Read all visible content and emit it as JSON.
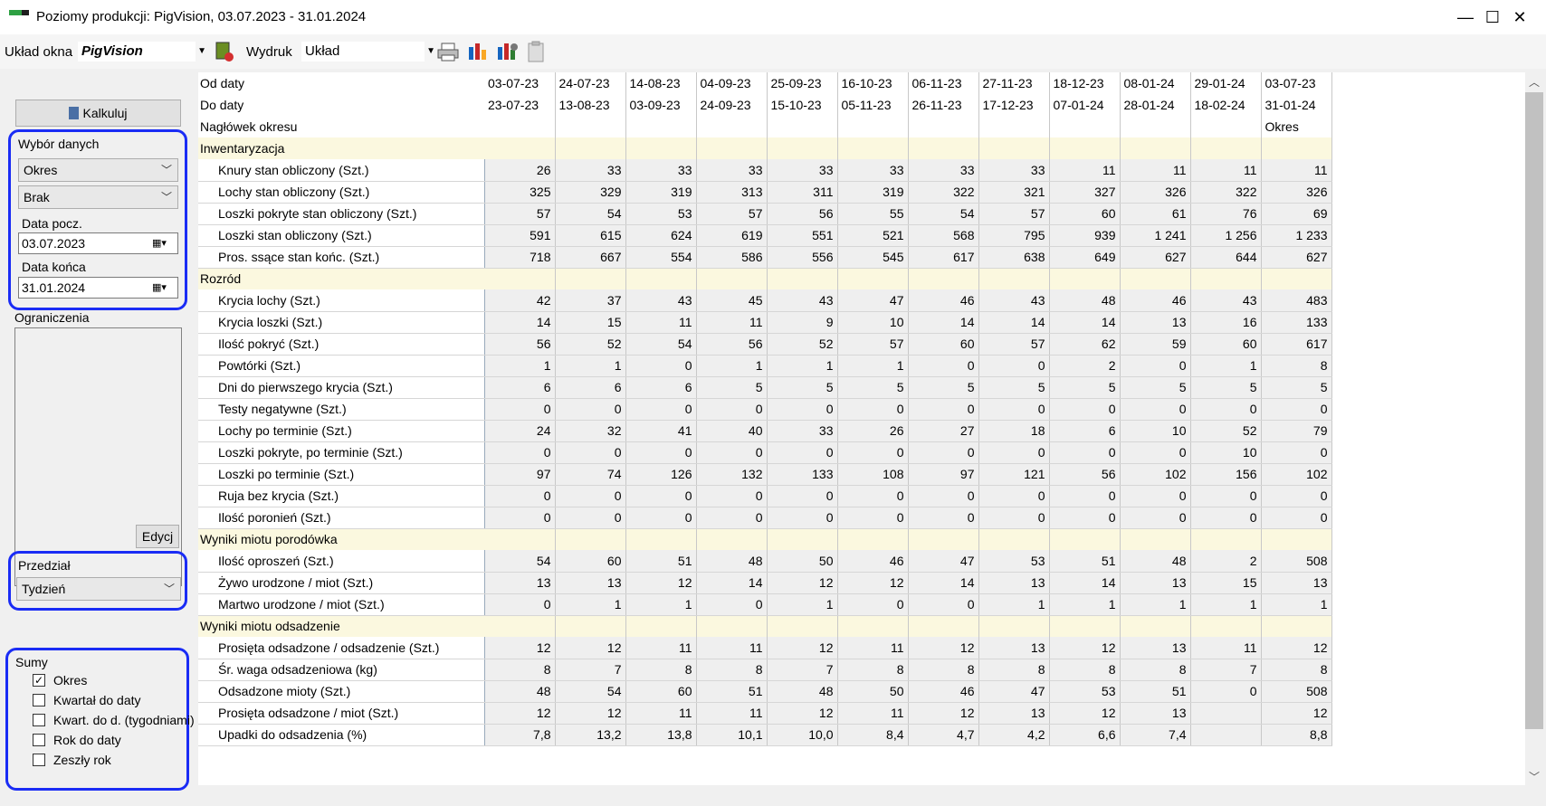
{
  "window": {
    "title": "Poziomy produkcji: PigVision, 03.07.2023 - 31.01.2024",
    "minimize": "—",
    "maximize": "☐",
    "close": "✕"
  },
  "toolbar": {
    "layout_label": "Układ okna",
    "layout_value": "PigVision",
    "print_label": "Wydruk",
    "print_value": "Układ"
  },
  "left": {
    "calc_button": "Kalkuluj",
    "data_selection_label": "Wybór danych",
    "combo1": "Okres",
    "combo2": "Brak",
    "start_label": "Data pocz.",
    "start_value": "03.07.2023",
    "end_label": "Data końca",
    "end_value": "31.01.2024",
    "restrictions_label": "Ograniczenia",
    "edit_button": "Edycj",
    "interval_label": "Przedział",
    "interval_value": "Tydzień",
    "sums_label": "Sumy",
    "sums": [
      {
        "label": "Okres",
        "checked": "✓"
      },
      {
        "label": "Kwartał do daty",
        "checked": ""
      },
      {
        "label": "Kwart. do d. (tygodniami)",
        "checked": ""
      },
      {
        "label": "Rok do daty",
        "checked": ""
      },
      {
        "label": "Zeszły rok",
        "checked": ""
      }
    ]
  },
  "grid": {
    "from_label": "Od daty",
    "to_label": "Do daty",
    "period_header_label": "Nagłówek okresu",
    "from": [
      "03-07-23",
      "24-07-23",
      "14-08-23",
      "04-09-23",
      "25-09-23",
      "16-10-23",
      "06-11-23",
      "27-11-23",
      "18-12-23",
      "08-01-24",
      "29-01-24",
      "03-07-23"
    ],
    "to": [
      "23-07-23",
      "13-08-23",
      "03-09-23",
      "24-09-23",
      "15-10-23",
      "05-11-23",
      "26-11-23",
      "17-12-23",
      "07-01-24",
      "28-01-24",
      "18-02-24",
      "31-01-24"
    ],
    "period_header": [
      "",
      "",
      "",
      "",
      "",
      "",
      "",
      "",
      "",
      "",
      "",
      "Okres"
    ],
    "rows": [
      {
        "section": "Inwentaryzacja"
      },
      {
        "label": "Knury stan obliczony (Szt.)",
        "values": [
          "26",
          "33",
          "33",
          "33",
          "33",
          "33",
          "33",
          "33",
          "11",
          "11",
          "11",
          "11"
        ]
      },
      {
        "label": "Lochy stan obliczony (Szt.)",
        "values": [
          "325",
          "329",
          "319",
          "313",
          "311",
          "319",
          "322",
          "321",
          "327",
          "326",
          "322",
          "326"
        ]
      },
      {
        "label": "Loszki pokryte stan obliczony (Szt.)",
        "values": [
          "57",
          "54",
          "53",
          "57",
          "56",
          "55",
          "54",
          "57",
          "60",
          "61",
          "76",
          "69"
        ]
      },
      {
        "label": "Loszki stan obliczony (Szt.)",
        "values": [
          "591",
          "615",
          "624",
          "619",
          "551",
          "521",
          "568",
          "795",
          "939",
          "1 241",
          "1 256",
          "1 233"
        ]
      },
      {
        "label": "Pros. ssące stan końc. (Szt.)",
        "values": [
          "718",
          "667",
          "554",
          "586",
          "556",
          "545",
          "617",
          "638",
          "649",
          "627",
          "644",
          "627"
        ]
      },
      {
        "section": "Rozród"
      },
      {
        "label": "Krycia lochy (Szt.)",
        "values": [
          "42",
          "37",
          "43",
          "45",
          "43",
          "47",
          "46",
          "43",
          "48",
          "46",
          "43",
          "483"
        ]
      },
      {
        "label": "Krycia loszki (Szt.)",
        "values": [
          "14",
          "15",
          "11",
          "11",
          "9",
          "10",
          "14",
          "14",
          "14",
          "13",
          "16",
          "133"
        ]
      },
      {
        "label": "Ilość pokryć (Szt.)",
        "values": [
          "56",
          "52",
          "54",
          "56",
          "52",
          "57",
          "60",
          "57",
          "62",
          "59",
          "60",
          "617"
        ]
      },
      {
        "label": "Powtórki (Szt.)",
        "values": [
          "1",
          "1",
          "0",
          "1",
          "1",
          "1",
          "0",
          "0",
          "2",
          "0",
          "1",
          "8"
        ]
      },
      {
        "label": "Dni do pierwszego krycia (Szt.)",
        "values": [
          "6",
          "6",
          "6",
          "5",
          "5",
          "5",
          "5",
          "5",
          "5",
          "5",
          "5",
          "5"
        ]
      },
      {
        "label": "Testy negatywne (Szt.)",
        "values": [
          "0",
          "0",
          "0",
          "0",
          "0",
          "0",
          "0",
          "0",
          "0",
          "0",
          "0",
          "0"
        ]
      },
      {
        "label": "Lochy po terminie (Szt.)",
        "values": [
          "24",
          "32",
          "41",
          "40",
          "33",
          "26",
          "27",
          "18",
          "6",
          "10",
          "52",
          "79"
        ]
      },
      {
        "label": "Loszki pokryte, po terminie (Szt.)",
        "values": [
          "0",
          "0",
          "0",
          "0",
          "0",
          "0",
          "0",
          "0",
          "0",
          "0",
          "10",
          "0"
        ]
      },
      {
        "label": "Loszki po terminie (Szt.)",
        "values": [
          "97",
          "74",
          "126",
          "132",
          "133",
          "108",
          "97",
          "121",
          "56",
          "102",
          "156",
          "102"
        ]
      },
      {
        "label": "Ruja bez krycia (Szt.)",
        "values": [
          "0",
          "0",
          "0",
          "0",
          "0",
          "0",
          "0",
          "0",
          "0",
          "0",
          "0",
          "0"
        ]
      },
      {
        "label": "Ilość poronień (Szt.)",
        "values": [
          "0",
          "0",
          "0",
          "0",
          "0",
          "0",
          "0",
          "0",
          "0",
          "0",
          "0",
          "0"
        ]
      },
      {
        "section": "Wyniki miotu porodówka"
      },
      {
        "label": "Ilość oproszeń (Szt.)",
        "values": [
          "54",
          "60",
          "51",
          "48",
          "50",
          "46",
          "47",
          "53",
          "51",
          "48",
          "2",
          "508"
        ]
      },
      {
        "label": "Żywo urodzone / miot (Szt.)",
        "values": [
          "13",
          "13",
          "12",
          "14",
          "12",
          "12",
          "14",
          "13",
          "14",
          "13",
          "15",
          "13"
        ]
      },
      {
        "label": "Martwo urodzone / miot (Szt.)",
        "values": [
          "0",
          "1",
          "1",
          "0",
          "1",
          "0",
          "0",
          "1",
          "1",
          "1",
          "1",
          "1"
        ]
      },
      {
        "section": "Wyniki miotu odsadzenie"
      },
      {
        "label": "Prosięta odsadzone / odsadzenie (Szt.)",
        "values": [
          "12",
          "12",
          "11",
          "11",
          "12",
          "11",
          "12",
          "13",
          "12",
          "13",
          "11",
          "12"
        ]
      },
      {
        "label": "Śr. waga odsadzeniowa (kg)",
        "values": [
          "8",
          "7",
          "8",
          "8",
          "7",
          "8",
          "8",
          "8",
          "8",
          "8",
          "7",
          "8"
        ]
      },
      {
        "label": "Odsadzone mioty (Szt.)",
        "values": [
          "48",
          "54",
          "60",
          "51",
          "48",
          "50",
          "46",
          "47",
          "53",
          "51",
          "0",
          "508"
        ]
      },
      {
        "label": "Prosięta odsadzone / miot (Szt.)",
        "values": [
          "12",
          "12",
          "11",
          "11",
          "12",
          "11",
          "12",
          "13",
          "12",
          "13",
          "",
          "12"
        ]
      },
      {
        "label": "Upadki do odsadzenia (%)",
        "values": [
          "7,8",
          "13,2",
          "13,8",
          "10,1",
          "10,0",
          "8,4",
          "4,7",
          "4,2",
          "6,6",
          "7,4",
          "",
          "8,8"
        ]
      }
    ]
  }
}
